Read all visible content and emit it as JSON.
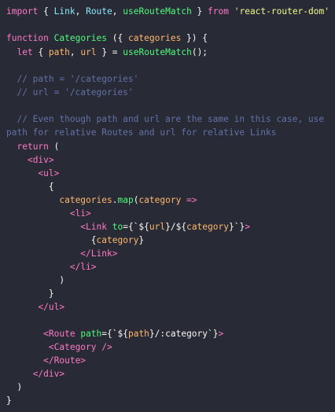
{
  "code": {
    "lines": [
      [
        [
          "kw",
          "import"
        ],
        [
          "pl",
          " { "
        ],
        [
          "cmp",
          "Link"
        ],
        [
          "pl",
          ", "
        ],
        [
          "cmp",
          "Route"
        ],
        [
          "pl",
          ", "
        ],
        [
          "fn",
          "useRouteMatch"
        ],
        [
          "pl",
          " } "
        ],
        [
          "kw",
          "from"
        ],
        [
          "pl",
          " "
        ],
        [
          "str",
          "'react-router-dom'"
        ]
      ],
      [],
      [
        [
          "kw",
          "function"
        ],
        [
          "pl",
          " "
        ],
        [
          "fn",
          "Categories"
        ],
        [
          "pl",
          " ({ "
        ],
        [
          "var",
          "categories"
        ],
        [
          "pl",
          " }) {"
        ]
      ],
      [
        [
          "pl",
          "  "
        ],
        [
          "kw",
          "let"
        ],
        [
          "pl",
          " { "
        ],
        [
          "var",
          "path"
        ],
        [
          "pl",
          ", "
        ],
        [
          "var",
          "url"
        ],
        [
          "pl",
          " } = "
        ],
        [
          "fn",
          "useRouteMatch"
        ],
        [
          "pl",
          "();"
        ]
      ],
      [],
      [
        [
          "cmt",
          "  // path = '/categories'"
        ]
      ],
      [
        [
          "cmt",
          "  // url = '/categories'"
        ]
      ],
      [],
      [
        [
          "cmt",
          "  // Even though path and url are the same in this case, use"
        ]
      ],
      [
        [
          "cmt",
          "path for relative Routes and url for relative Links"
        ]
      ],
      [
        [
          "pl",
          "  "
        ],
        [
          "kw",
          "return"
        ],
        [
          "pl",
          " ("
        ]
      ],
      [
        [
          "pl",
          "    "
        ],
        [
          "tag",
          "<div>"
        ]
      ],
      [
        [
          "pl",
          "      "
        ],
        [
          "tag",
          "<ul>"
        ]
      ],
      [
        [
          "pl",
          "        {"
        ]
      ],
      [
        [
          "pl",
          "          "
        ],
        [
          "var",
          "categories"
        ],
        [
          "pl",
          "."
        ],
        [
          "fn",
          "map"
        ],
        [
          "pl",
          "("
        ],
        [
          "var",
          "category"
        ],
        [
          "pl",
          " "
        ],
        [
          "kw",
          "=>"
        ]
      ],
      [
        [
          "pl",
          "            "
        ],
        [
          "tag",
          "<li>"
        ]
      ],
      [
        [
          "pl",
          "              "
        ],
        [
          "tag",
          "<Link"
        ],
        [
          "pl",
          " "
        ],
        [
          "attr",
          "to"
        ],
        [
          "pl",
          "={`${"
        ],
        [
          "var",
          "url"
        ],
        [
          "pl",
          "}/${"
        ],
        [
          "var",
          "category"
        ],
        [
          "pl",
          "}`}"
        ],
        [
          "tag",
          ">"
        ]
      ],
      [
        [
          "pl",
          "                {"
        ],
        [
          "var",
          "category"
        ],
        [
          "pl",
          "}"
        ]
      ],
      [
        [
          "pl",
          "              "
        ],
        [
          "tag",
          "</Link>"
        ]
      ],
      [
        [
          "pl",
          "            "
        ],
        [
          "tag",
          "</li>"
        ]
      ],
      [
        [
          "pl",
          "          )"
        ]
      ],
      [
        [
          "pl",
          "        }"
        ]
      ],
      [
        [
          "pl",
          "      "
        ],
        [
          "tag",
          "</ul>"
        ]
      ],
      [],
      [
        [
          "pl",
          "       "
        ],
        [
          "tag",
          "<Route"
        ],
        [
          "pl",
          " "
        ],
        [
          "attr",
          "path"
        ],
        [
          "pl",
          "={`${"
        ],
        [
          "var",
          "path"
        ],
        [
          "pl",
          "}/:category`}"
        ],
        [
          "tag",
          ">"
        ]
      ],
      [
        [
          "pl",
          "        "
        ],
        [
          "tag",
          "<Category />"
        ]
      ],
      [
        [
          "pl",
          "       "
        ],
        [
          "tag",
          "</Route>"
        ]
      ],
      [
        [
          "pl",
          "     "
        ],
        [
          "tag",
          "</div>"
        ]
      ],
      [
        [
          "pl",
          "  )"
        ]
      ],
      [
        [
          "pl",
          "}"
        ]
      ]
    ]
  }
}
